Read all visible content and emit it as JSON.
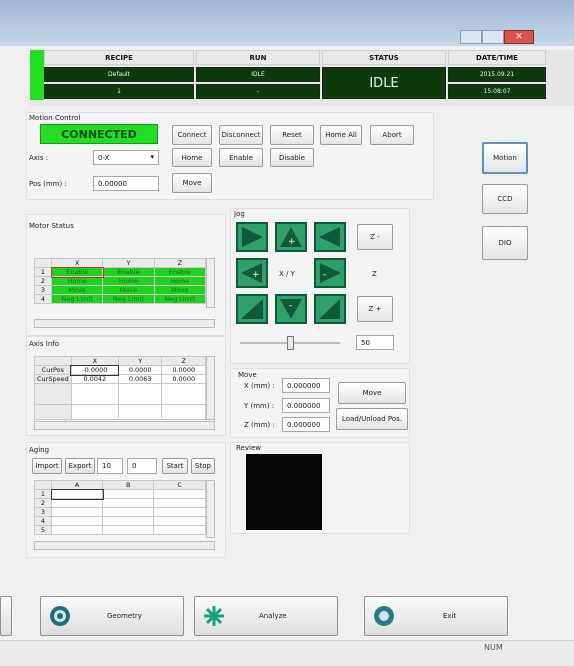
{
  "header": {
    "cols": [
      "RECIPE",
      "RUN",
      "STATUS",
      "DATE/TIME"
    ],
    "recipe_name": "Default",
    "recipe_num": "1",
    "run_state": "IDLE",
    "run_sub": "-",
    "status": "IDLE",
    "date": "2015.09.21",
    "time": "15:08:07"
  },
  "motion": {
    "title": "Motion Control",
    "connection": "CONNECTED",
    "buttons": [
      "Connect",
      "Disconnect",
      "Reset",
      "Home All",
      "Abort"
    ],
    "home": "Home",
    "enable": "Enable",
    "disable": "Disable",
    "move": "Move",
    "axis_label": "Axis :",
    "axis_value": "0-X",
    "pos_label": "Pos (mm) :",
    "pos_value": "0.00000"
  },
  "side_tabs": [
    "Motion",
    "CCD",
    "DIO"
  ],
  "motor_status": {
    "title": "Motor Status",
    "cols": [
      "X",
      "Y",
      "Z"
    ],
    "rows": [
      {
        "n": "1",
        "cells": [
          "Enable",
          "Enable",
          "Enable"
        ]
      },
      {
        "n": "2",
        "cells": [
          "Home",
          "Home",
          "Home"
        ]
      },
      {
        "n": "3",
        "cells": [
          "Move",
          "Move",
          "Move"
        ]
      },
      {
        "n": "4",
        "cells": [
          "Neg Limit",
          "Neg Limit",
          "Neg Limit"
        ]
      }
    ]
  },
  "jog": {
    "title": "Jog",
    "z_minus": "Z -",
    "z_plus": "Z +",
    "z_label": "Z",
    "xy_label": "X / Y",
    "speed": "50",
    "slider_fraction": 0.5
  },
  "axis_info": {
    "title": "Axis Info",
    "cols": [
      "X",
      "Y",
      "Z"
    ],
    "rows": [
      {
        "name": "CurPos",
        "cells": [
          "-0.0000",
          "0.0000",
          "0.0000"
        ]
      },
      {
        "name": "CurSpeed",
        "cells": [
          "0.0042",
          "0.0063",
          "0.0000"
        ]
      }
    ]
  },
  "move": {
    "title": "Move",
    "x_label": "X (mm) :",
    "x_value": "0.000000",
    "y_label": "Y (mm) :",
    "y_value": "0.000000",
    "z_label": "Z (mm) :",
    "z_value": "0.000000",
    "move_btn": "Move",
    "load_btn": "Load/Unload Pos."
  },
  "aging": {
    "title": "Aging",
    "import": "Import",
    "export": "Export",
    "count": "10",
    "done": "0",
    "start": "Start",
    "stop": "Stop",
    "cols": [
      "A",
      "B",
      "C"
    ],
    "rows": [
      "1",
      "2",
      "3",
      "4",
      "5"
    ]
  },
  "review": {
    "title": "Review"
  },
  "bottom": {
    "geometry": "Geometry",
    "analyze": "Analyze",
    "exit": "Exit"
  },
  "statusbar": {
    "num": "NUM"
  },
  "colors": {
    "connected_bg": "#22dd22",
    "header_dark": "#0c3a0c",
    "jog_green": "#2f9f6b"
  }
}
